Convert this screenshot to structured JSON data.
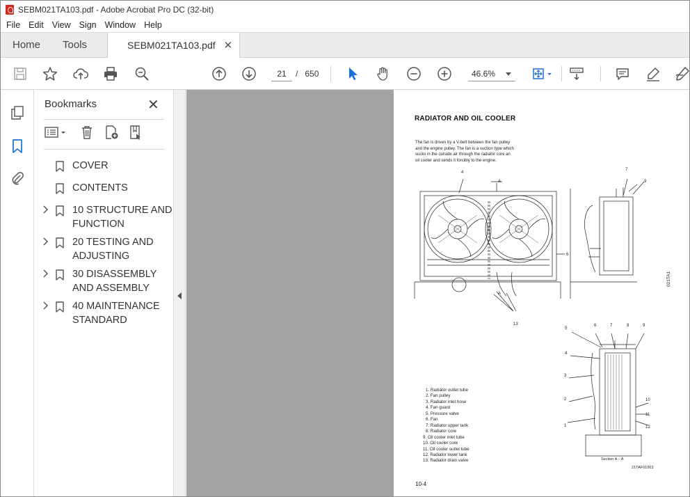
{
  "window": {
    "title": "SEBM021TA103.pdf - Adobe Acrobat Pro DC (32-bit)"
  },
  "menu": [
    "File",
    "Edit",
    "View",
    "Sign",
    "Window",
    "Help"
  ],
  "tabs": {
    "home": "Home",
    "tools": "Tools",
    "document": "SEBM021TA103.pdf"
  },
  "toolbar": {
    "page_current": "21",
    "page_separator": "/",
    "page_total": "650",
    "zoom": "46.6%"
  },
  "bookmarks": {
    "title": "Bookmarks",
    "items": [
      {
        "label": "COVER",
        "expandable": false
      },
      {
        "label": "CONTENTS",
        "expandable": false
      },
      {
        "label": "10 STRUCTURE AND\nFUNCTION",
        "expandable": true
      },
      {
        "label": "20 TESTING AND\nADJUSTING",
        "expandable": true
      },
      {
        "label": "30 DISASSEMBLY\nAND ASSEMBLY",
        "expandable": true
      },
      {
        "label": "40 MAINTENANCE\nSTANDARD",
        "expandable": true
      }
    ]
  },
  "pdf_page": {
    "title": "RADIATOR AND OIL COOLER",
    "intro": "The fan is driven by a V-belt between the fan pulley\nand the engine pulley. The fan is a suction type which\nsucks in the outside air through the radiator core an\noil cooler and sends it forcibly to the engine.",
    "legend": [
      "1. Radiator outlet tube",
      "2. Fan pulley",
      "3. Radiator inlet hose",
      "4. Fan guard",
      "5. Pressure valve",
      "6. Fan",
      "7. Radiator upper tank",
      "8. Radiator core",
      "9. Oil cooler inlet tube",
      "10. Oil cooler core",
      "11. Oil cooler outlet tube",
      "12. Radiator lower tank",
      "13. Radiator drain valve"
    ],
    "figure_code_1": "021TA1",
    "section_label": "Section A – A",
    "figure_code_2": "21TAF01003",
    "page_number": "10-4",
    "callouts_top": [
      "4",
      "A",
      "6",
      "7",
      "9",
      "A",
      "13"
    ],
    "callouts_bottom": [
      "5",
      "6",
      "7",
      "8",
      "9",
      "4",
      "3",
      "2",
      "1",
      "10",
      "11",
      "12"
    ]
  }
}
